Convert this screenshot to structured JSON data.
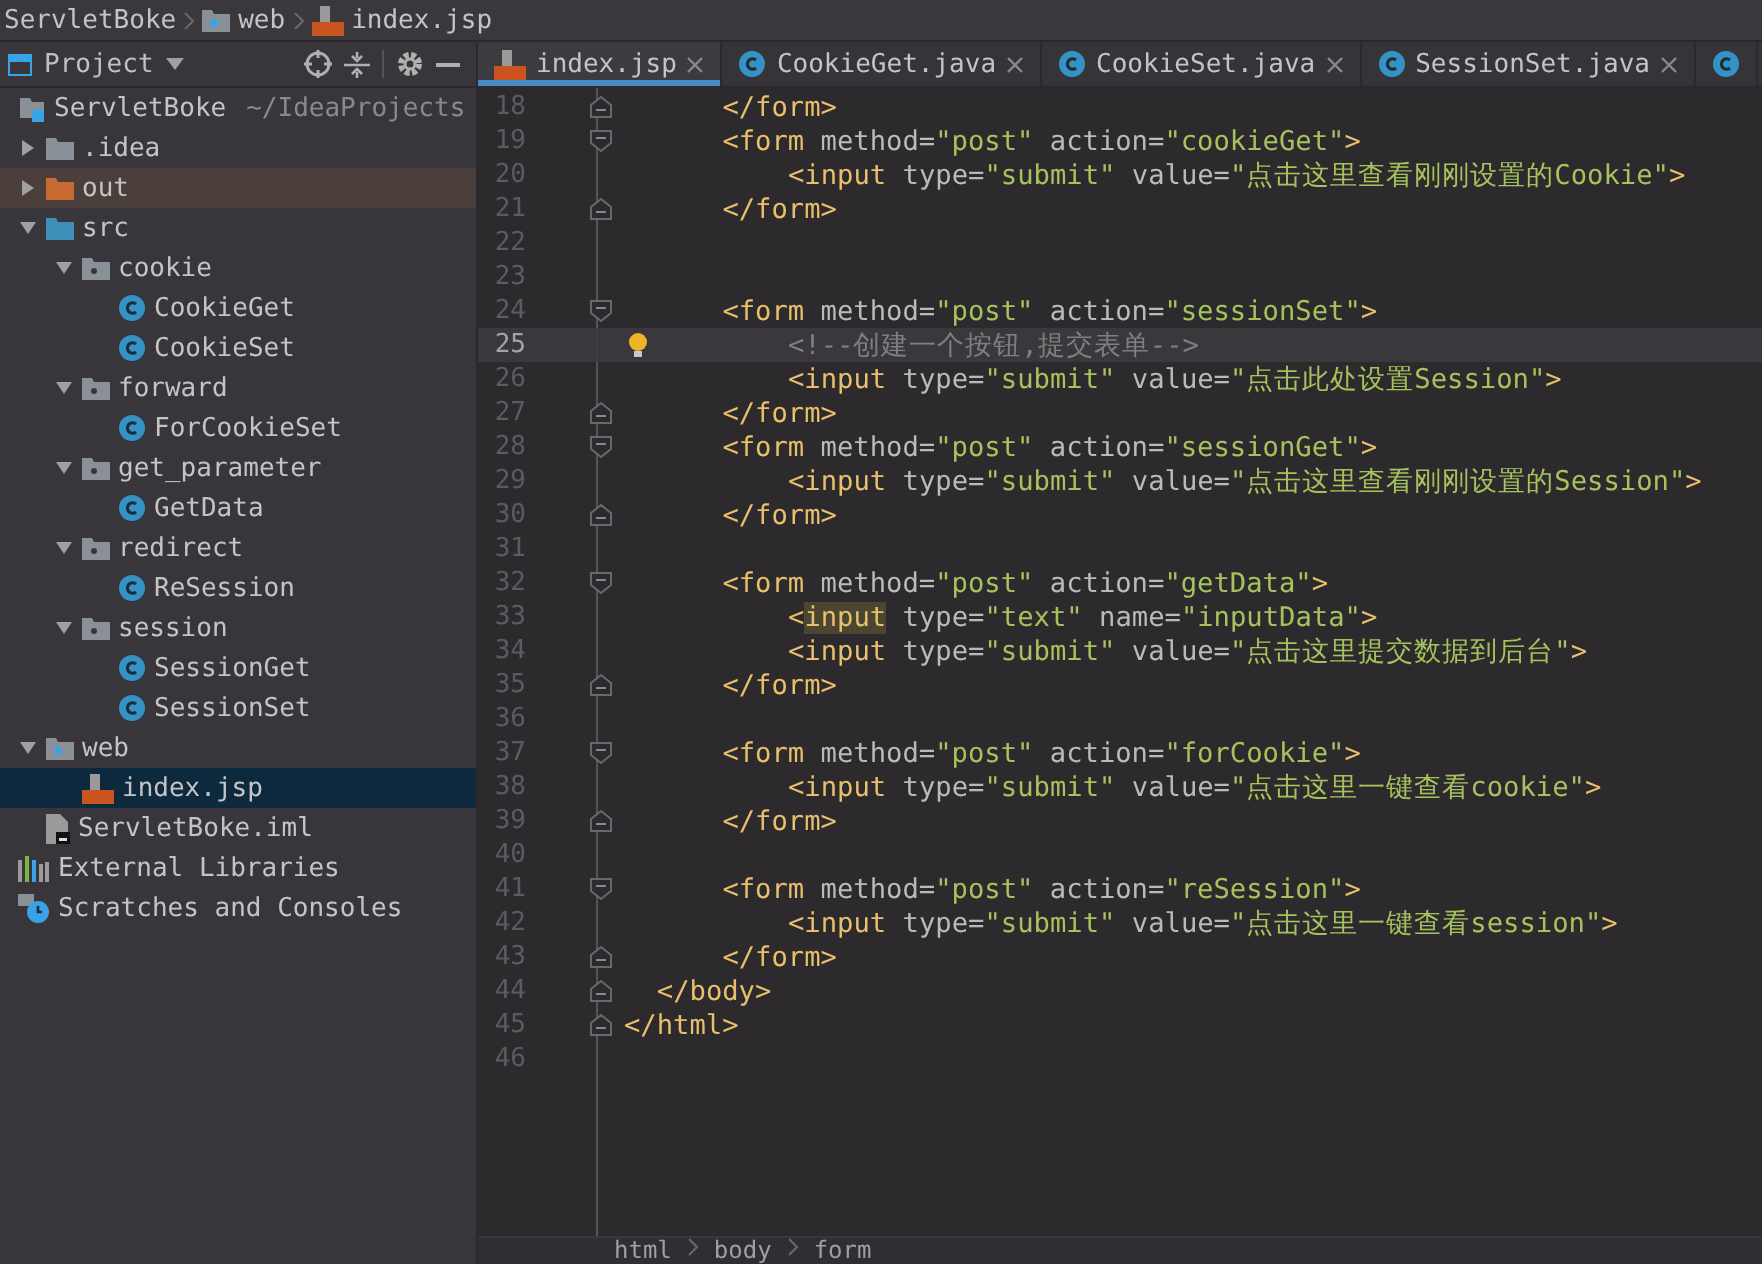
{
  "breadcrumb": [
    "ServletBoke",
    "web",
    "index.jsp"
  ],
  "project_panel": {
    "title": "Project"
  },
  "tree": [
    {
      "label": "ServletBoke",
      "path": "~/IdeaProjects",
      "kind": "module",
      "selected": false,
      "children": [
        {
          "label": ".idea",
          "kind": "folder",
          "expanded": false,
          "selected": false
        },
        {
          "label": "out",
          "kind": "excluded-folder",
          "expanded": false,
          "selected": false
        },
        {
          "label": "src",
          "kind": "source-folder",
          "expanded": true,
          "selected": false,
          "children": [
            {
              "label": "cookie",
              "kind": "package",
              "expanded": true,
              "selected": false,
              "children": [
                {
                  "label": "CookieGet",
                  "kind": "class",
                  "selected": false
                },
                {
                  "label": "CookieSet",
                  "kind": "class",
                  "selected": false
                }
              ]
            },
            {
              "label": "forward",
              "kind": "package",
              "expanded": true,
              "selected": false,
              "children": [
                {
                  "label": "ForCookieSet",
                  "kind": "class",
                  "selected": false
                }
              ]
            },
            {
              "label": "get_parameter",
              "kind": "package",
              "expanded": true,
              "selected": false,
              "children": [
                {
                  "label": "GetData",
                  "kind": "class",
                  "selected": false
                }
              ]
            },
            {
              "label": "redirect",
              "kind": "package",
              "expanded": true,
              "selected": false,
              "children": [
                {
                  "label": "ReSession",
                  "kind": "class",
                  "selected": false
                }
              ]
            },
            {
              "label": "session",
              "kind": "package",
              "expanded": true,
              "selected": false,
              "children": [
                {
                  "label": "SessionGet",
                  "kind": "class",
                  "selected": false
                },
                {
                  "label": "SessionSet",
                  "kind": "class",
                  "selected": false
                }
              ]
            }
          ]
        },
        {
          "label": "web",
          "kind": "web-folder",
          "expanded": true,
          "selected": false,
          "children": [
            {
              "label": "index.jsp",
              "kind": "jsp",
              "selected": true
            }
          ]
        },
        {
          "label": "ServletBoke.iml",
          "kind": "iml",
          "selected": false
        }
      ]
    },
    {
      "label": "External Libraries",
      "kind": "libraries",
      "selected": false
    },
    {
      "label": "Scratches and Consoles",
      "kind": "scratches",
      "selected": false
    }
  ],
  "tabs": [
    {
      "label": "index.jsp",
      "kind": "jsp",
      "selected": true
    },
    {
      "label": "CookieGet.java",
      "kind": "class",
      "selected": false
    },
    {
      "label": "CookieSet.java",
      "kind": "class",
      "selected": false
    },
    {
      "label": "SessionSet.java",
      "kind": "class",
      "selected": false
    }
  ],
  "code_lines": [
    {
      "number": "18",
      "fold_open": false,
      "fold_close": true,
      "current": false,
      "segments": [
        {
          "kind": "tag",
          "text": "      </form>"
        }
      ]
    },
    {
      "number": "19",
      "fold_open": true,
      "fold_close": false,
      "current": false,
      "segments": [
        {
          "kind": "tag",
          "text": "      <form "
        },
        {
          "kind": "attr",
          "text": "method="
        },
        {
          "kind": "string",
          "text": "\"post\" "
        },
        {
          "kind": "attr",
          "text": "action="
        },
        {
          "kind": "string",
          "text": "\"cookieGet\""
        },
        {
          "kind": "tag",
          "text": ">"
        }
      ]
    },
    {
      "number": "20",
      "fold_open": false,
      "fold_close": false,
      "current": false,
      "segments": [
        {
          "kind": "tag",
          "text": "          <input "
        },
        {
          "kind": "attr",
          "text": "type="
        },
        {
          "kind": "string",
          "text": "\"submit\" "
        },
        {
          "kind": "attr",
          "text": "value="
        },
        {
          "kind": "string",
          "text": "\"点击这里查看刚刚设置的Cookie\""
        },
        {
          "kind": "tag",
          "text": ">"
        }
      ]
    },
    {
      "number": "21",
      "fold_open": false,
      "fold_close": true,
      "current": false,
      "segments": [
        {
          "kind": "tag",
          "text": "      </form>"
        }
      ]
    },
    {
      "number": "22",
      "fold_open": false,
      "fold_close": false,
      "current": false
    },
    {
      "number": "23",
      "fold_open": false,
      "fold_close": false,
      "current": false
    },
    {
      "number": "24",
      "fold_open": true,
      "fold_close": false,
      "current": false,
      "segments": [
        {
          "kind": "tag",
          "text": "      <form "
        },
        {
          "kind": "attr",
          "text": "method="
        },
        {
          "kind": "string",
          "text": "\"post\" "
        },
        {
          "kind": "attr",
          "text": "action="
        },
        {
          "kind": "string",
          "text": "\"sessionSet\""
        },
        {
          "kind": "tag",
          "text": ">"
        }
      ]
    },
    {
      "number": "25",
      "fold_open": false,
      "fold_close": false,
      "current": true,
      "segments": [
        {
          "kind": "comment",
          "text": "          <!--创建一个按钮,提交表单-->"
        }
      ]
    },
    {
      "number": "26",
      "fold_open": false,
      "fold_close": false,
      "current": false,
      "segments": [
        {
          "kind": "tag",
          "text": "          <input "
        },
        {
          "kind": "attr",
          "text": "type="
        },
        {
          "kind": "string",
          "text": "\"submit\" "
        },
        {
          "kind": "attr",
          "text": "value="
        },
        {
          "kind": "string",
          "text": "\"点击此处设置Session\""
        },
        {
          "kind": "tag",
          "text": ">"
        }
      ]
    },
    {
      "number": "27",
      "fold_open": false,
      "fold_close": true,
      "current": false,
      "segments": [
        {
          "kind": "tag",
          "text": "      </form>"
        }
      ]
    },
    {
      "number": "28",
      "fold_open": true,
      "fold_close": false,
      "current": false,
      "segments": [
        {
          "kind": "tag",
          "text": "      <form "
        },
        {
          "kind": "attr",
          "text": "method="
        },
        {
          "kind": "string",
          "text": "\"post\" "
        },
        {
          "kind": "attr",
          "text": "action="
        },
        {
          "kind": "string",
          "text": "\"sessionGet\""
        },
        {
          "kind": "tag",
          "text": ">"
        }
      ]
    },
    {
      "number": "29",
      "fold_open": false,
      "fold_close": false,
      "current": false,
      "segments": [
        {
          "kind": "tag",
          "text": "          <input "
        },
        {
          "kind": "attr",
          "text": "type="
        },
        {
          "kind": "string",
          "text": "\"submit\" "
        },
        {
          "kind": "attr",
          "text": "value="
        },
        {
          "kind": "string",
          "text": "\"点击这里查看刚刚设置的Session\""
        },
        {
          "kind": "tag",
          "text": ">"
        }
      ]
    },
    {
      "number": "30",
      "fold_open": false,
      "fold_close": true,
      "current": false,
      "segments": [
        {
          "kind": "tag",
          "text": "      </form>"
        }
      ]
    },
    {
      "number": "31",
      "fold_open": false,
      "fold_close": false,
      "current": false
    },
    {
      "number": "32",
      "fold_open": true,
      "fold_close": false,
      "current": false,
      "segments": [
        {
          "kind": "tag",
          "text": "      <form "
        },
        {
          "kind": "attr",
          "text": "method="
        },
        {
          "kind": "string",
          "text": "\"post\" "
        },
        {
          "kind": "attr",
          "text": "action="
        },
        {
          "kind": "string",
          "text": "\"getData\""
        },
        {
          "kind": "tag",
          "text": ">"
        }
      ]
    },
    {
      "number": "33",
      "fold_open": false,
      "fold_close": false,
      "current": false,
      "segments": [
        {
          "kind": "tag",
          "text": "          <"
        },
        {
          "kind": "match",
          "text": "input"
        },
        {
          "kind": "attr",
          "text": " type="
        },
        {
          "kind": "string",
          "text": "\"text\" "
        },
        {
          "kind": "attr",
          "text": "name="
        },
        {
          "kind": "string",
          "text": "\"inputData\""
        },
        {
          "kind": "tag",
          "text": ">"
        }
      ]
    },
    {
      "number": "34",
      "fold_open": false,
      "fold_close": false,
      "current": false,
      "segments": [
        {
          "kind": "tag",
          "text": "          <input "
        },
        {
          "kind": "attr",
          "text": "type="
        },
        {
          "kind": "string",
          "text": "\"submit\" "
        },
        {
          "kind": "attr",
          "text": "value="
        },
        {
          "kind": "string",
          "text": "\"点击这里提交数据到后台\""
        },
        {
          "kind": "tag",
          "text": ">"
        }
      ]
    },
    {
      "number": "35",
      "fold_open": false,
      "fold_close": true,
      "current": false,
      "segments": [
        {
          "kind": "tag",
          "text": "      </form>"
        }
      ]
    },
    {
      "number": "36",
      "fold_open": false,
      "fold_close": false,
      "current": false
    },
    {
      "number": "37",
      "fold_open": true,
      "fold_close": false,
      "current": false,
      "segments": [
        {
          "kind": "tag",
          "text": "      <form "
        },
        {
          "kind": "attr",
          "text": "method="
        },
        {
          "kind": "string",
          "text": "\"post\" "
        },
        {
          "kind": "attr",
          "text": "action="
        },
        {
          "kind": "string",
          "text": "\"forCookie\""
        },
        {
          "kind": "tag",
          "text": ">"
        }
      ]
    },
    {
      "number": "38",
      "fold_open": false,
      "fold_close": false,
      "current": false,
      "segments": [
        {
          "kind": "tag",
          "text": "          <input "
        },
        {
          "kind": "attr",
          "text": "type="
        },
        {
          "kind": "string",
          "text": "\"submit\" "
        },
        {
          "kind": "attr",
          "text": "value="
        },
        {
          "kind": "string",
          "text": "\"点击这里一键查看cookie\""
        },
        {
          "kind": "tag",
          "text": ">"
        }
      ]
    },
    {
      "number": "39",
      "fold_open": false,
      "fold_close": true,
      "current": false,
      "segments": [
        {
          "kind": "tag",
          "text": "      </form>"
        }
      ]
    },
    {
      "number": "40",
      "fold_open": false,
      "fold_close": false,
      "current": false
    },
    {
      "number": "41",
      "fold_open": true,
      "fold_close": false,
      "current": false,
      "segments": [
        {
          "kind": "tag",
          "text": "      <form "
        },
        {
          "kind": "attr",
          "text": "method="
        },
        {
          "kind": "string",
          "text": "\"post\" "
        },
        {
          "kind": "attr",
          "text": "action="
        },
        {
          "kind": "string",
          "text": "\"reSession\""
        },
        {
          "kind": "tag",
          "text": ">"
        }
      ]
    },
    {
      "number": "42",
      "fold_open": false,
      "fold_close": false,
      "current": false,
      "segments": [
        {
          "kind": "tag",
          "text": "          <input "
        },
        {
          "kind": "attr",
          "text": "type="
        },
        {
          "kind": "string",
          "text": "\"submit\" "
        },
        {
          "kind": "attr",
          "text": "value="
        },
        {
          "kind": "string",
          "text": "\"点击这里一键查看session\""
        },
        {
          "kind": "tag",
          "text": ">"
        }
      ]
    },
    {
      "number": "43",
      "fold_open": false,
      "fold_close": true,
      "current": false,
      "segments": [
        {
          "kind": "tag",
          "text": "      </form>"
        }
      ]
    },
    {
      "number": "44",
      "fold_open": false,
      "fold_close": true,
      "current": false,
      "segments": [
        {
          "kind": "tag",
          "text": "  </body>"
        }
      ]
    },
    {
      "number": "45",
      "fold_open": false,
      "fold_close": true,
      "current": false,
      "segments": [
        {
          "kind": "tag",
          "text": "</html>"
        }
      ]
    },
    {
      "number": "46",
      "fold_open": false,
      "fold_close": false,
      "current": false
    }
  ],
  "editor_breadcrumb": [
    "html",
    "body",
    "form"
  ]
}
